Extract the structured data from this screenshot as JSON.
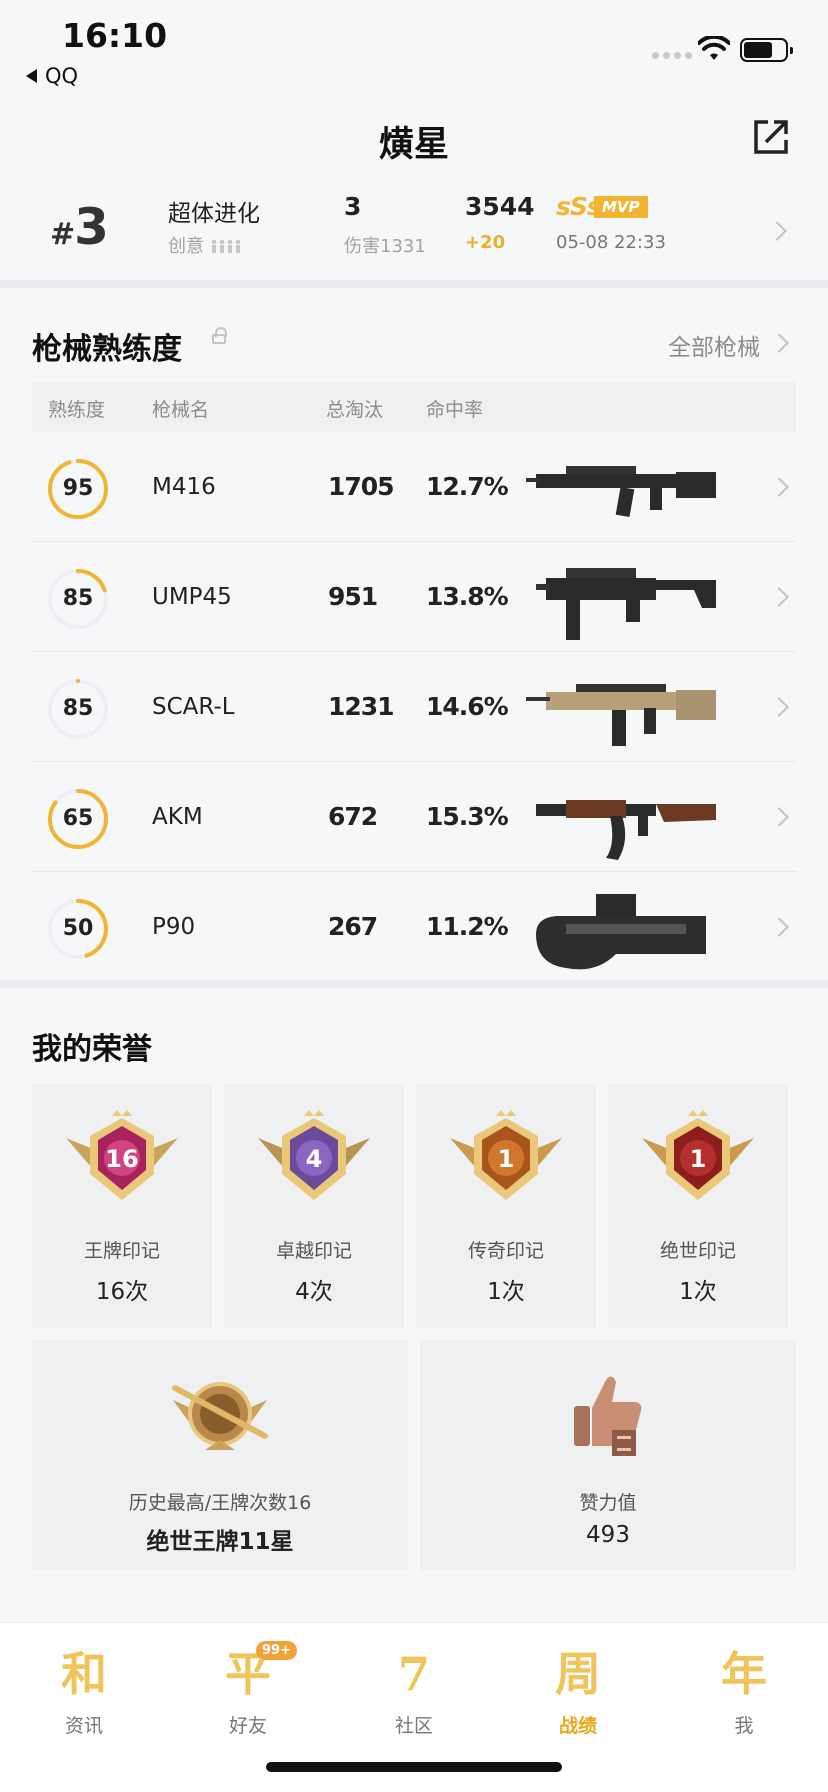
{
  "status_bar": {
    "time": "16:10",
    "back_app": "QQ"
  },
  "header": {
    "title": "熿星"
  },
  "match": {
    "rank": "3",
    "mode": "超体进化",
    "mode_sub": "创意",
    "kills": "3",
    "damage": "伤害1331",
    "score": "3544",
    "score_delta": "+20",
    "grade": "sSs",
    "mvp": "MVP",
    "date": "05-08 22:33"
  },
  "weapons": {
    "title": "枪械熟练度",
    "all_link": "全部枪械",
    "columns": [
      "熟练度",
      "枪械名",
      "总淘汰",
      "命中率"
    ],
    "rows": [
      {
        "proficiency": "95",
        "name": "M416",
        "kills": "1705",
        "rate": "12.7%",
        "progress": 0.95
      },
      {
        "proficiency": "85",
        "name": "UMP45",
        "kills": "951",
        "rate": "13.8%",
        "progress": 0.2
      },
      {
        "proficiency": "85",
        "name": "SCAR-L",
        "kills": "1231",
        "rate": "14.6%",
        "progress": 0.0
      },
      {
        "proficiency": "65",
        "name": "AKM",
        "kills": "672",
        "rate": "15.3%",
        "progress": 0.85
      },
      {
        "proficiency": "50",
        "name": "P90",
        "kills": "267",
        "rate": "11.2%",
        "progress": 0.45
      }
    ]
  },
  "honors": {
    "title": "我的荣誉",
    "badges": [
      {
        "label": "王牌印记",
        "count": "16次",
        "icon_text": "16"
      },
      {
        "label": "卓越印记",
        "count": "4次",
        "icon_text": "4"
      },
      {
        "label": "传奇印记",
        "count": "1次",
        "icon_text": "1"
      },
      {
        "label": "绝世印记",
        "count": "1次",
        "icon_text": "1"
      }
    ],
    "best": {
      "label": "历史最高/王牌次数16",
      "value": "绝世王牌11星"
    },
    "likes": {
      "label": "赞力值",
      "value": "493"
    }
  },
  "tabbar": {
    "tabs": [
      {
        "glyph": "和",
        "label": "资讯"
      },
      {
        "glyph": "平",
        "label": "好友",
        "badge": "99+"
      },
      {
        "glyph": "7",
        "label": "社区"
      },
      {
        "glyph": "周",
        "label": "战绩",
        "active": true
      },
      {
        "glyph": "年",
        "label": "我"
      }
    ]
  },
  "colors": {
    "accent": "#f2b531",
    "ring_track": "#eceef1"
  }
}
